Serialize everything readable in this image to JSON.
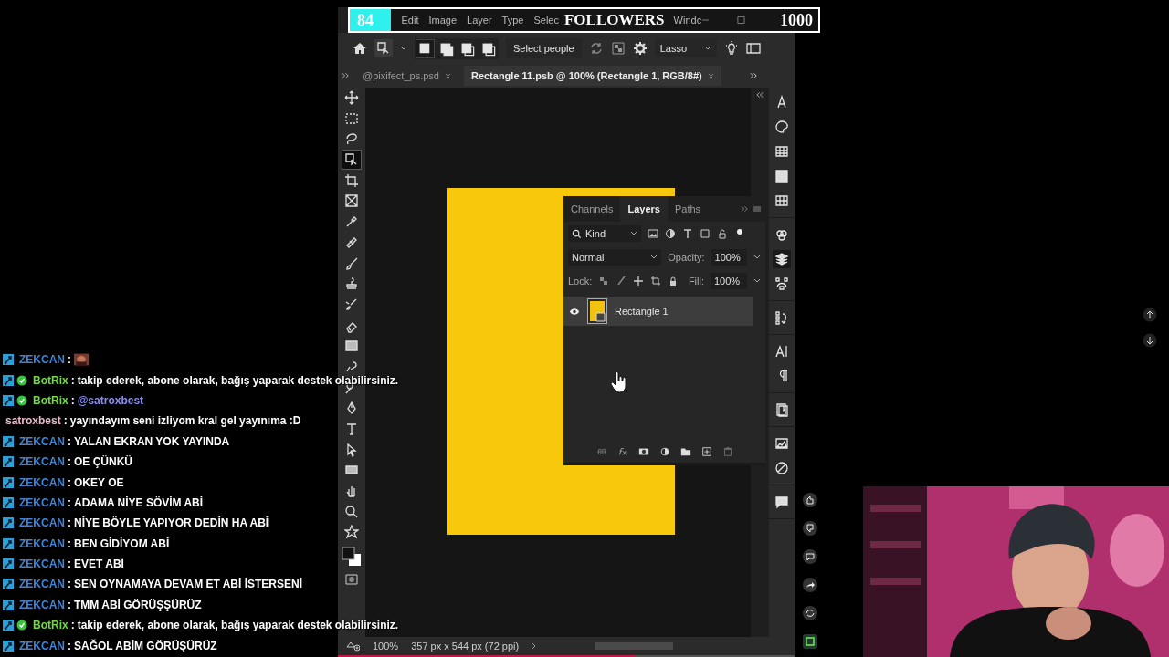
{
  "follower_goal": {
    "current": "84",
    "label": "FOLLOWERS",
    "target": "1000",
    "level": 0.087
  },
  "menu": [
    "Edit",
    "Image",
    "Layer",
    "Type",
    "Selec",
    "Windc"
  ],
  "options_bar": {
    "select_button": "Select people",
    "mode_dropdown": "Lasso",
    "modes": [
      {
        "selected": true
      },
      {
        "selected": false
      },
      {
        "selected": false
      },
      {
        "selected": false
      }
    ]
  },
  "document_tabs": [
    {
      "label": "@pixifect_ps.psd",
      "selected": false
    },
    {
      "label": "Rectangle 11.psb @ 100% (Rectangle 1, RGB/8#)",
      "selected": true
    }
  ],
  "tools": [
    {
      "kind": "move",
      "selected": false
    },
    {
      "kind": "marquee",
      "selected": false
    },
    {
      "kind": "lasso",
      "selected": false
    },
    {
      "kind": "object-select",
      "selected": true
    },
    {
      "kind": "crop",
      "selected": false
    },
    {
      "kind": "frame",
      "selected": false
    },
    {
      "kind": "eyedropper",
      "selected": false
    },
    {
      "kind": "healing",
      "selected": false
    },
    {
      "kind": "brush",
      "selected": false
    },
    {
      "kind": "stamp",
      "selected": false
    },
    {
      "kind": "history-brush",
      "selected": false
    },
    {
      "kind": "eraser",
      "selected": false
    },
    {
      "kind": "gradient",
      "selected": false
    },
    {
      "kind": "smudge",
      "selected": false
    },
    {
      "kind": "dodge",
      "selected": false
    },
    {
      "kind": "pen",
      "selected": false
    },
    {
      "kind": "type",
      "selected": false
    },
    {
      "kind": "path-select",
      "selected": false
    },
    {
      "kind": "rectangle",
      "selected": false
    },
    {
      "kind": "hand",
      "selected": false
    },
    {
      "kind": "zoom",
      "selected": false
    },
    {
      "kind": "star",
      "selected": false
    }
  ],
  "panel_dock": [
    {
      "icons": [
        {
          "kind": "glyphs",
          "selected": false
        },
        {
          "kind": "color",
          "selected": false
        },
        {
          "kind": "swatches",
          "selected": false
        },
        {
          "kind": "gradients",
          "selected": false
        },
        {
          "kind": "patterns",
          "selected": false
        }
      ]
    },
    {
      "icons": [
        {
          "kind": "channels",
          "selected": false
        },
        {
          "kind": "layers",
          "selected": true
        },
        {
          "kind": "paths",
          "selected": false
        }
      ]
    },
    {
      "icons": [
        {
          "kind": "history",
          "selected": false
        }
      ]
    },
    {
      "icons": [
        {
          "kind": "character",
          "selected": false
        },
        {
          "kind": "paragraph",
          "selected": false
        }
      ]
    },
    {
      "icons": [
        {
          "kind": "libraries",
          "selected": false
        }
      ]
    },
    {
      "icons": [
        {
          "kind": "properties",
          "selected": false
        },
        {
          "kind": "adjustments",
          "selected": false
        }
      ]
    },
    {
      "icons": [
        {
          "kind": "comments",
          "selected": false
        }
      ]
    }
  ],
  "layers_panel": {
    "tabs": [
      {
        "label": "Channels",
        "selected": false
      },
      {
        "label": "Layers",
        "selected": true
      },
      {
        "label": "Paths",
        "selected": false
      }
    ],
    "filter": "Kind",
    "blend_mode": "Normal",
    "opacity_label": "Opacity:",
    "opacity": "100%",
    "lock_label": "Lock:",
    "fill_label": "Fill:",
    "fill": "100%",
    "layers": [
      {
        "name": "Rectangle 1",
        "visible": true,
        "selected": true
      }
    ]
  },
  "status_bar": {
    "zoom": "100%",
    "document_info": "357 px x 544 px (72 ppi)"
  },
  "chat_separator_note": ":",
  "chat": [
    {
      "user": "ZEKCAN",
      "color": "#3f86d8",
      "moderator": true,
      "verified": false,
      "kind": "emote"
    },
    {
      "user": "BotRix",
      "color": "#72d944",
      "moderator": true,
      "verified": true,
      "kind": "text",
      "text": "takip ederek, abone olarak, bağış yaparak destek olabilirsiniz."
    },
    {
      "user": "BotRix",
      "color": "#72d944",
      "moderator": true,
      "verified": true,
      "kind": "mention",
      "text": "@satroxbest"
    },
    {
      "user": "satroxbest",
      "color": "#e9b9c9",
      "moderator": false,
      "verified": false,
      "kind": "text",
      "text": "yayındayım seni izliyom kral gel yayınıma :D"
    },
    {
      "user": "ZEKCAN",
      "color": "#3f86d8",
      "moderator": true,
      "verified": false,
      "kind": "text",
      "text": "YALAN EKRAN YOK YAYINDA"
    },
    {
      "user": "ZEKCAN",
      "color": "#3f86d8",
      "moderator": true,
      "verified": false,
      "kind": "text",
      "text": "OE ÇÜNKÜ"
    },
    {
      "user": "ZEKCAN",
      "color": "#3f86d8",
      "moderator": true,
      "verified": false,
      "kind": "text",
      "text": "OKEY OE"
    },
    {
      "user": "ZEKCAN",
      "color": "#3f86d8",
      "moderator": true,
      "verified": false,
      "kind": "text",
      "text": "ADAMA NİYE SÖVİM ABİ"
    },
    {
      "user": "ZEKCAN",
      "color": "#3f86d8",
      "moderator": true,
      "verified": false,
      "kind": "text",
      "text": "NİYE BÖYLE YAPIYOR DEDİN HA ABİ"
    },
    {
      "user": "ZEKCAN",
      "color": "#3f86d8",
      "moderator": true,
      "verified": false,
      "kind": "text",
      "text": "BEN GİDİYOM ABİ"
    },
    {
      "user": "ZEKCAN",
      "color": "#3f86d8",
      "moderator": true,
      "verified": false,
      "kind": "text",
      "text": "EVET ABİ"
    },
    {
      "user": "ZEKCAN",
      "color": "#3f86d8",
      "moderator": true,
      "verified": false,
      "kind": "text",
      "text": "SEN OYNAMAYA DEVAM ET ABİ İSTERSENİ"
    },
    {
      "user": "ZEKCAN",
      "color": "#3f86d8",
      "moderator": true,
      "verified": false,
      "kind": "text",
      "text": "TMM ABİ GÖRÜŞŞÜRÜZ"
    },
    {
      "user": "BotRix",
      "color": "#72d944",
      "moderator": true,
      "verified": true,
      "kind": "text",
      "text": "takip ederek, abone olarak, bağış yaparak destek olabilirsiniz."
    },
    {
      "user": "ZEKCAN",
      "color": "#3f86d8",
      "moderator": true,
      "verified": false,
      "kind": "text",
      "text": "SAĞOL ABİM GÖRÜŞÜRÜZ"
    }
  ]
}
